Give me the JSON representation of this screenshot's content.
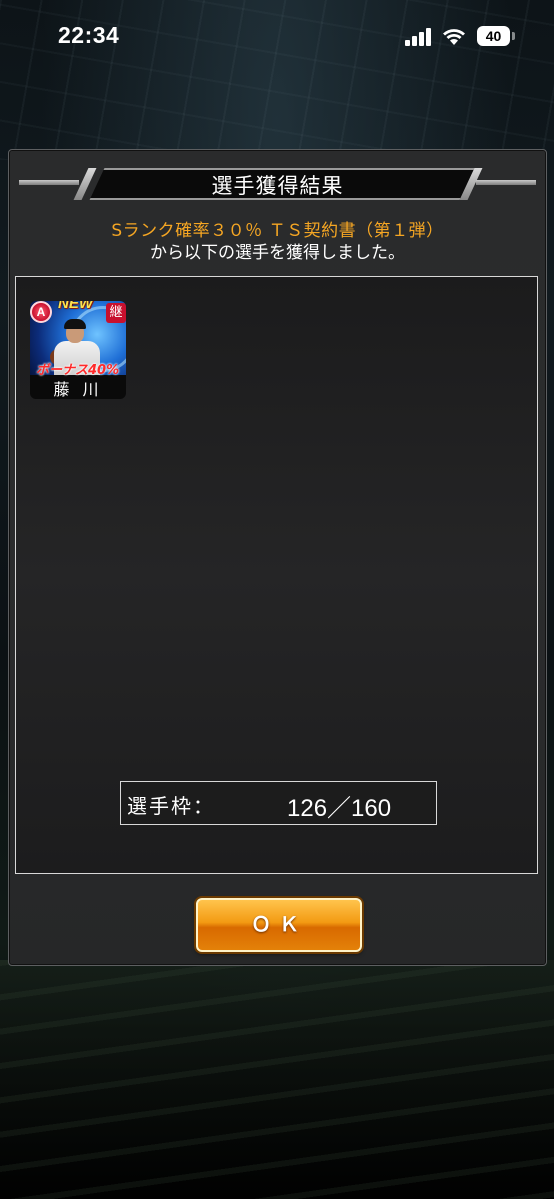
{
  "status_bar": {
    "time": "22:34",
    "battery": "40"
  },
  "dialog": {
    "title": "選手獲得結果",
    "contract_name": "Sランク確率３０％ ＴＳ契約書（第１弾）",
    "message": "から以下の選手を獲得しました。",
    "players": [
      {
        "name": "藤 川",
        "rank": "A",
        "new_label": "NEW",
        "inherit_badge": "継",
        "bonus": "ボーナス40%"
      }
    ],
    "roster": {
      "label": "選手枠：",
      "count": "126／160"
    },
    "ok_label": "ＯＫ"
  },
  "colors": {
    "accent_orange": "#f5a623",
    "button_orange": "#f39a12",
    "panel_border": "#d8d8d8"
  }
}
